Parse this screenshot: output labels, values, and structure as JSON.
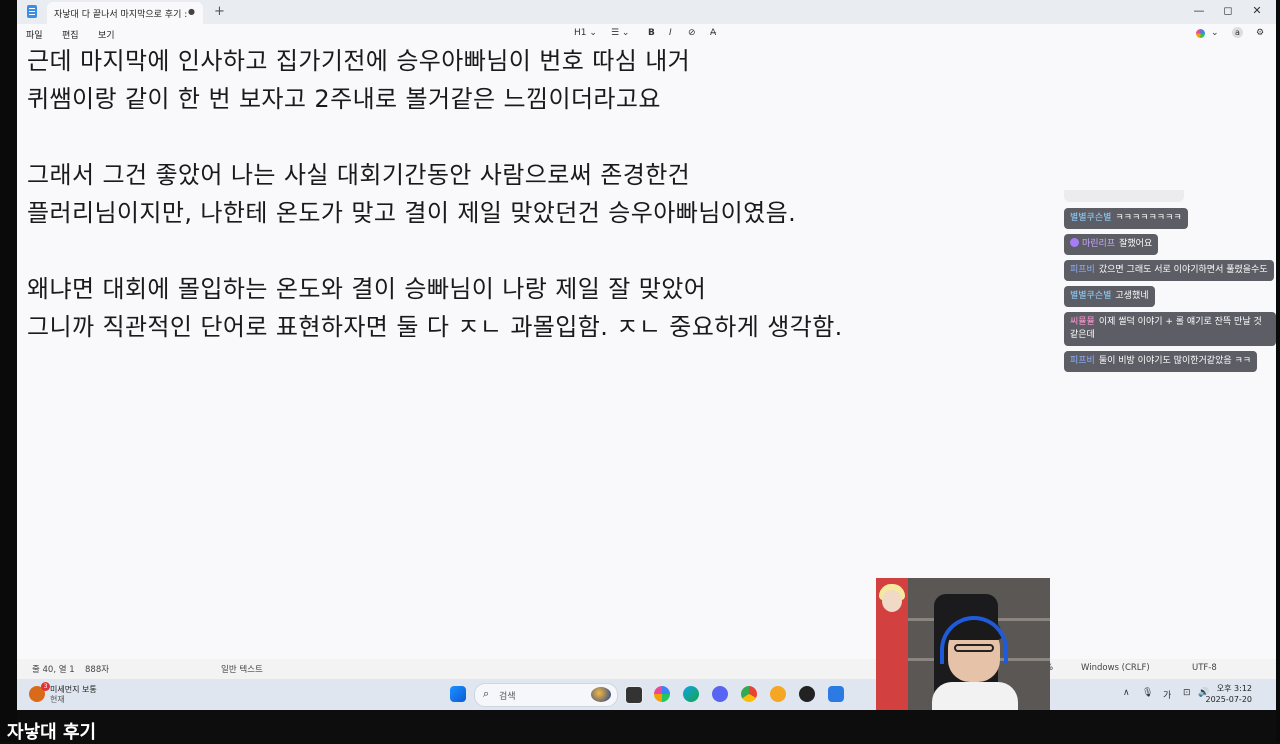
{
  "window": {
    "tab_title": "자낳대 다 끝나서 마지막으로 후기 :",
    "tab_close": "●",
    "new_tab": "+",
    "controls": [
      "—",
      "◻",
      "✕"
    ]
  },
  "menu": {
    "file": "파일",
    "edit": "편집",
    "view": "보기"
  },
  "toolbar": {
    "heading": "H1 ⌄",
    "list": "☰ ⌄",
    "bold": "B",
    "italic": "I",
    "link": "⊘",
    "clear": "A̶",
    "copilot": "⌄",
    "account": "a",
    "settings": "⚙"
  },
  "document": {
    "lines": [
      "근데 마지막에 인사하고 집가기전에 승우아빠님이 번호 따심 내거",
      "퀴쌤이랑 같이 한 번 보자고 2주내로 볼거같은 느낌이더라고요",
      "",
      "그래서 그건 좋았어 나는 사실 대회기간동안 사람으로써 존경한건",
      "플러리님이지만, 나한테 온도가 맞고 결이 제일 맞았던건 승우아빠님이였음.",
      "",
      "왜냐면 대회에 몰입하는 온도와 결이 승빠님이 나랑 제일 잘 맞았어",
      "그니까 직관적인 단어로 표현하자면 둘 다 ㅈㄴ 과몰입함. ㅈㄴ 중요하게 생각함."
    ]
  },
  "status": {
    "position": "줄 40, 열 1",
    "chars": "888자",
    "format": "일반 텍스트",
    "zoom": "%",
    "line_ending": "Windows (CRLF)",
    "encoding": "UTF-8"
  },
  "taskbar": {
    "weather_badge": "3",
    "weather_title": "미세먼지 보통",
    "weather_sub": "현재",
    "search_label": "검색",
    "tray_up": "∧",
    "tray_mic": "🎙",
    "tray_lang": "가",
    "tray_net": "⊡",
    "tray_vol": "🔊",
    "time": "오후 3:12",
    "date": "2025-07-20"
  },
  "chat": {
    "messages": [
      {
        "nick": "별별쿠슨별",
        "text": "ㅋㅋㅋㅋㅋㅋㅋㅋ",
        "nick_color": "#8fd3ff"
      },
      {
        "nick": "마린리프",
        "text": "잘했어요",
        "nick_color": "#c9a6ff",
        "heart": true
      },
      {
        "nick": "피프비",
        "text": "갔으면 그래도 서로 이야기하면서 풀렸을수도",
        "nick_color": "#8fb0ff"
      },
      {
        "nick": "별별쿠슨별",
        "text": "고생했네",
        "nick_color": "#8fd3ff"
      },
      {
        "nick": "씨뮬뮬",
        "text": "이제 썰덕 이야기 + 롤 얘기로 잔뜩 만날 것같은데",
        "nick_color": "#ff9ad5"
      },
      {
        "nick": "피프비",
        "text": "둘이 비방 이야기도 많이한거같았음 ㅋㅋ",
        "nick_color": "#8fb0ff"
      }
    ]
  },
  "overlay": {
    "bottom_title": "자낳대 후기"
  }
}
